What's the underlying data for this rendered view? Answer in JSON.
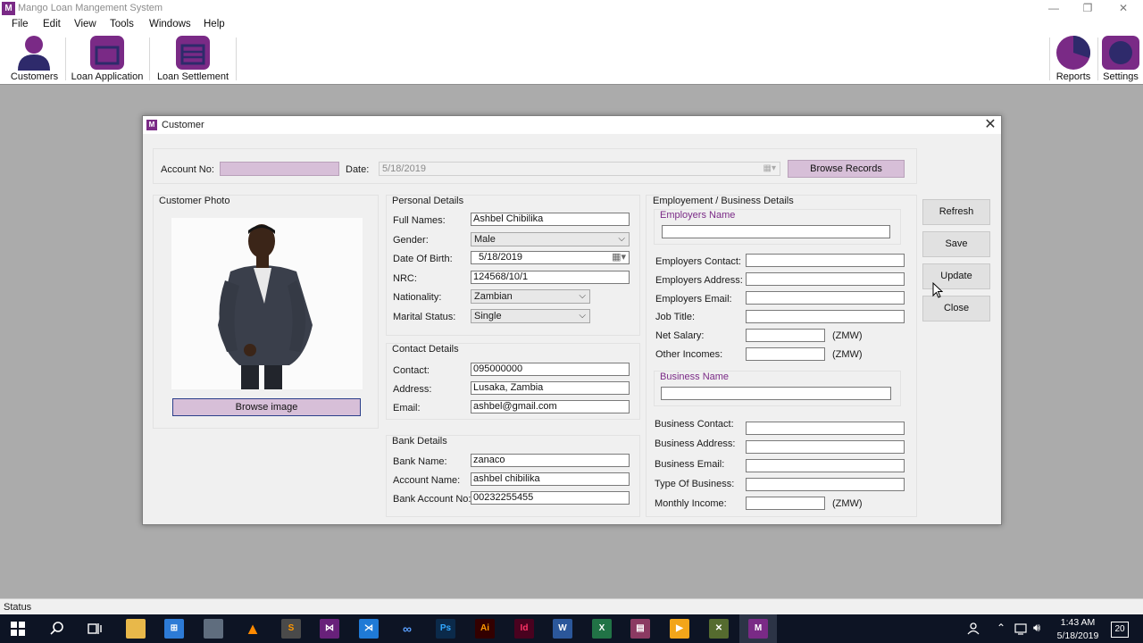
{
  "app": {
    "title": "Mango Loan Mangement System",
    "logo_text": "M"
  },
  "window_controls": {
    "minimize": "—",
    "restore": "❐",
    "close": "✕"
  },
  "menu": [
    "File",
    "Edit",
    "View",
    "Tools",
    "Windows",
    "Help"
  ],
  "toolbar": {
    "customers": "Customers",
    "loan_application": "Loan Application",
    "loan_settlement": "Loan Settlement",
    "reports": "Reports",
    "settings": "Settings"
  },
  "colors": {
    "accent": "#7a2a86",
    "accent_dark": "#2e2a6b",
    "field_purple": "#d7bfd8"
  },
  "dialog": {
    "title": "Customer",
    "close": "✕",
    "top": {
      "account_no_label": "Account No:",
      "account_no_value": "",
      "date_label": "Date:",
      "date_value": "5/18/2019",
      "browse_records": "Browse Records"
    },
    "photo": {
      "title": "Customer Photo",
      "browse_image": "Browse image"
    },
    "personal": {
      "title": "Personal Details",
      "full_names_label": "Full Names:",
      "full_names": "Ashbel Chibilika",
      "gender_label": "Gender:",
      "gender": "Male",
      "dob_label": "Date Of Birth:",
      "dob": "5/18/2019",
      "nrc_label": "NRC:",
      "nrc": "124568/10/1",
      "nationality_label": "Nationality:",
      "nationality": "Zambian",
      "marital_label": "Marital Status:",
      "marital": "Single"
    },
    "contact": {
      "title": "Contact Details",
      "contact_label": "Contact:",
      "contact": "095000000",
      "address_label": "Address:",
      "address": "Lusaka, Zambia",
      "email_label": "Email:",
      "email": "ashbel@gmail.com"
    },
    "bank": {
      "title": "Bank Details",
      "bank_name_label": "Bank Name:",
      "bank_name": "zanaco",
      "account_name_label": "Account Name:",
      "account_name": "ashbel chibilika",
      "account_no_label": "Bank Account No:",
      "account_no": "00232255455"
    },
    "employment": {
      "title": "Employement / Business Details",
      "employers_name_title": "Employers Name",
      "employers_name": "",
      "employers_contact_label": "Employers Contact:",
      "employers_address_label": "Employers Address:",
      "employers_email_label": "Employers Email:",
      "job_title_label": "Job Title:",
      "net_salary_label": "Net Salary:",
      "other_incomes_label": "Other Incomes:",
      "currency": "(ZMW)",
      "business_name_title": "Business Name",
      "business_name": "",
      "business_contact_label": "Business Contact:",
      "business_address_label": "Business Address:",
      "business_email_label": "Business Email:",
      "business_type_label": "Type Of Business:",
      "monthly_income_label": "Monthly Income:"
    },
    "actions": {
      "refresh": "Refresh",
      "save": "Save",
      "update": "Update",
      "close": "Close"
    }
  },
  "status": "Status",
  "taskbar": {
    "time": "1:43 AM",
    "date": "5/18/2019",
    "notification_count": "20",
    "apps": [
      "windows-start",
      "search",
      "task-view",
      "file-explorer",
      "store",
      "vmware",
      "vlc",
      "sublime",
      "visual-studio",
      "vscode",
      "link",
      "photoshop",
      "illustrator",
      "indesign",
      "word",
      "excel",
      "winrar",
      "media-player",
      "tools",
      "mango-loan"
    ]
  }
}
